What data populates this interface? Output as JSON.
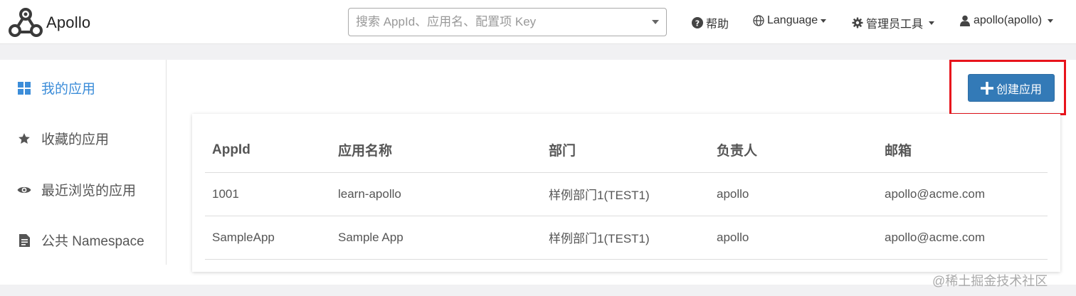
{
  "header": {
    "app_name": "Apollo",
    "search_placeholder": "搜索 AppId、应用名、配置项 Key",
    "help_label": "帮助",
    "language_label": "Language",
    "admin_tools_label": "管理员工具",
    "user_label": "apollo(apollo)"
  },
  "sidebar": {
    "items": [
      {
        "label": "我的应用",
        "icon": "grid-icon",
        "active": true
      },
      {
        "label": "收藏的应用",
        "icon": "star-icon",
        "active": false
      },
      {
        "label": "最近浏览的应用",
        "icon": "eye-icon",
        "active": false
      },
      {
        "label": "公共 Namespace",
        "icon": "document-icon",
        "active": false
      }
    ]
  },
  "actions": {
    "create_app_label": "创建应用"
  },
  "table": {
    "headers": [
      "AppId",
      "应用名称",
      "部门",
      "负责人",
      "邮箱"
    ],
    "rows": [
      [
        "1001",
        "learn-apollo",
        "样例部门1(TEST1)",
        "apollo",
        "apollo@acme.com"
      ],
      [
        "SampleApp",
        "Sample App",
        "样例部门1(TEST1)",
        "apollo",
        "apollo@acme.com"
      ]
    ]
  },
  "watermark": "@稀土掘金技术社区",
  "colors": {
    "accent": "#3c8dd9",
    "primary_button": "#337ab7",
    "highlight_border": "#e8141c",
    "background": "#f1f1f3"
  }
}
